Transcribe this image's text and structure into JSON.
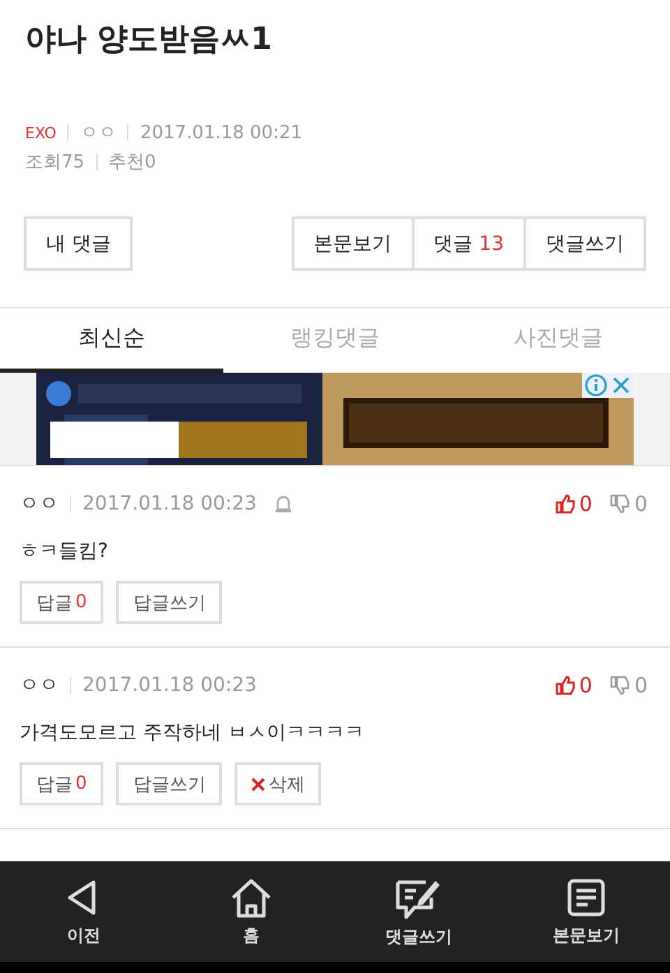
{
  "post": {
    "title": "야나 양도받음ㅆ1",
    "board": "EXO",
    "author": "ㅇㅇ",
    "date": "2017.01.18 00:21",
    "views_label": "조회",
    "views": "75",
    "likes_label": "추천",
    "likes": "0"
  },
  "buttons": {
    "my_comments": "내 댓글",
    "view_post": "본문보기",
    "comments_label": "댓글",
    "comments_count": "13",
    "write_comment": "댓글쓰기"
  },
  "tabs": [
    {
      "label": "최신순",
      "selected": true
    },
    {
      "label": "랭킹댓글",
      "selected": false
    },
    {
      "label": "사진댓글",
      "selected": false
    }
  ],
  "comments": [
    {
      "author": "ㅇㅇ",
      "date": "2017.01.18 00:23",
      "flag_icon": true,
      "up": "0",
      "down": "0",
      "text": "ㅎㅋ들킴?",
      "reply_label": "답글",
      "replies": "0",
      "write_reply": "답글쓰기"
    },
    {
      "author": "ㅇㅇ",
      "date": "2017.01.18 00:23",
      "flag_icon": false,
      "up": "0",
      "down": "0",
      "text": "가격도모르고 주작하네 ㅂㅅ이ㅋㅋㅋㅋ",
      "reply_label": "답글",
      "replies": "0",
      "write_reply": "답글쓰기",
      "delete": "삭제"
    }
  ],
  "nav": [
    {
      "kind": "back",
      "label": "이전"
    },
    {
      "kind": "home",
      "label": "홈"
    },
    {
      "kind": "write",
      "label": "댓글쓰기"
    },
    {
      "kind": "post",
      "label": "본문보기"
    }
  ]
}
